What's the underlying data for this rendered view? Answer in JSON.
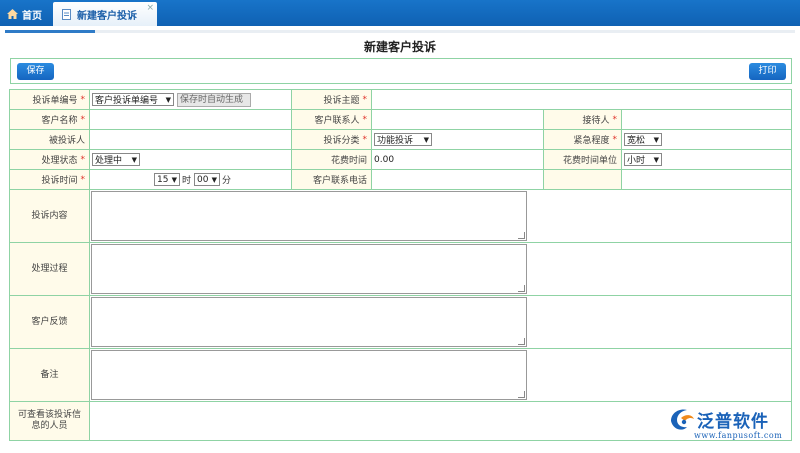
{
  "tabs": {
    "home": "首页",
    "active": "新建客户投诉",
    "close": "×"
  },
  "page_title": "新建客户投诉",
  "toolbar": {
    "save": "保存",
    "print": "打印"
  },
  "form": {
    "complaint_no": {
      "label": "投诉单编号",
      "select": "客户投诉单编号",
      "auto": "保存时自动生成"
    },
    "complaint_subject": {
      "label": "投诉主题"
    },
    "customer_name": {
      "label": "客户名称"
    },
    "customer_contact": {
      "label": "客户联系人"
    },
    "receiver": {
      "label": "接待人"
    },
    "complained_person": {
      "label": "被投诉人"
    },
    "category": {
      "label": "投诉分类",
      "value": "功能投诉"
    },
    "urgency": {
      "label": "紧急程度",
      "value": "宽松"
    },
    "status": {
      "label": "处理状态",
      "value": "处理中"
    },
    "time_spent": {
      "label": "花费时间",
      "value": "0.00"
    },
    "time_unit": {
      "label": "花费时间单位",
      "value": "小时"
    },
    "complaint_time": {
      "label": "投诉时间",
      "hour": "15",
      "hour_unit": "时",
      "minute": "00",
      "minute_unit": "分"
    },
    "customer_phone": {
      "label": "客户联系电话"
    },
    "content": {
      "label": "投诉内容"
    },
    "process": {
      "label": "处理过程"
    },
    "feedback": {
      "label": "客户反馈"
    },
    "remark": {
      "label": "备注"
    },
    "viewers": {
      "label": "可查看该投诉信息的人员"
    }
  },
  "required_mark": "*",
  "logo": {
    "name": "泛普软件",
    "url": "www.fanpusoft.com"
  },
  "colors": {
    "header": "#1874c9",
    "border": "#8fd3a4",
    "label_bg": "#fffbea",
    "required": "#e0322a"
  }
}
